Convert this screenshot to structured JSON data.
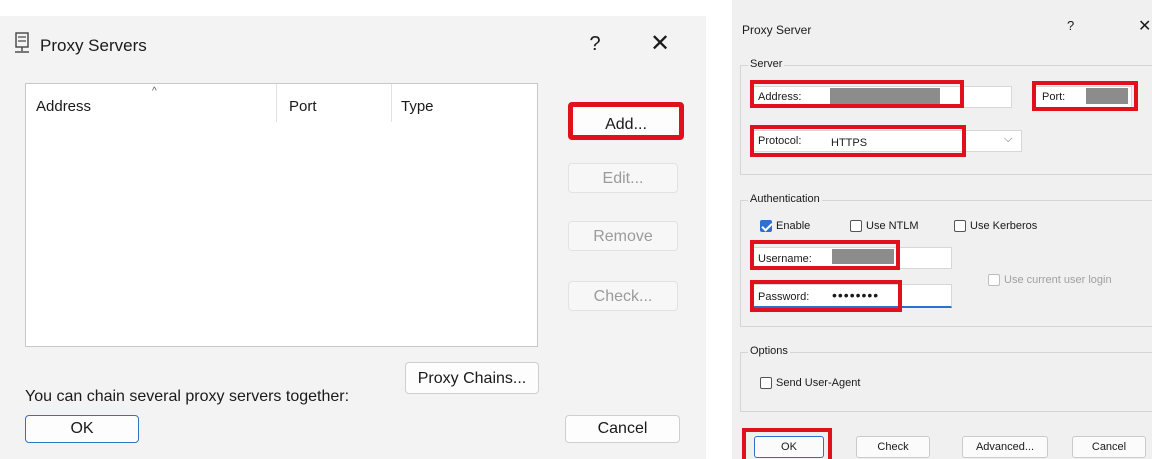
{
  "left_dialog": {
    "title": "Proxy Servers",
    "help_glyph": "?",
    "close_glyph": "✕",
    "columns": [
      "Address",
      "Port",
      "Type"
    ],
    "sort_glyph": "^",
    "buttons": {
      "add": "Add...",
      "edit": "Edit...",
      "remove": "Remove",
      "check": "Check..."
    },
    "chain_label": "You can chain several proxy servers together:",
    "proxy_chains": "Proxy Chains...",
    "ok": "OK",
    "cancel": "Cancel"
  },
  "right_dialog": {
    "title": "Proxy Server",
    "help_glyph": "?",
    "close_glyph": "✕",
    "server_group": "Server",
    "address_label": "Address:",
    "port_label": "Port:",
    "protocol_label": "Protocol:",
    "protocol_value": "HTTPS",
    "dropdown_glyph": "⌵",
    "auth_group": "Authentication",
    "enable_label": "Enable",
    "ntlm_label": "Use NTLM",
    "kerberos_label": "Use Kerberos",
    "username_label": "Username:",
    "password_label": "Password:",
    "password_value": "••••••••",
    "current_user_label": "Use current user login",
    "options_group": "Options",
    "user_agent_label": "Send User-Agent",
    "buttons": {
      "ok": "OK",
      "check": "Check",
      "advanced": "Advanced...",
      "cancel": "Cancel"
    }
  },
  "colors": {
    "highlight": "#e0101c",
    "accent": "#2e6fd0"
  }
}
